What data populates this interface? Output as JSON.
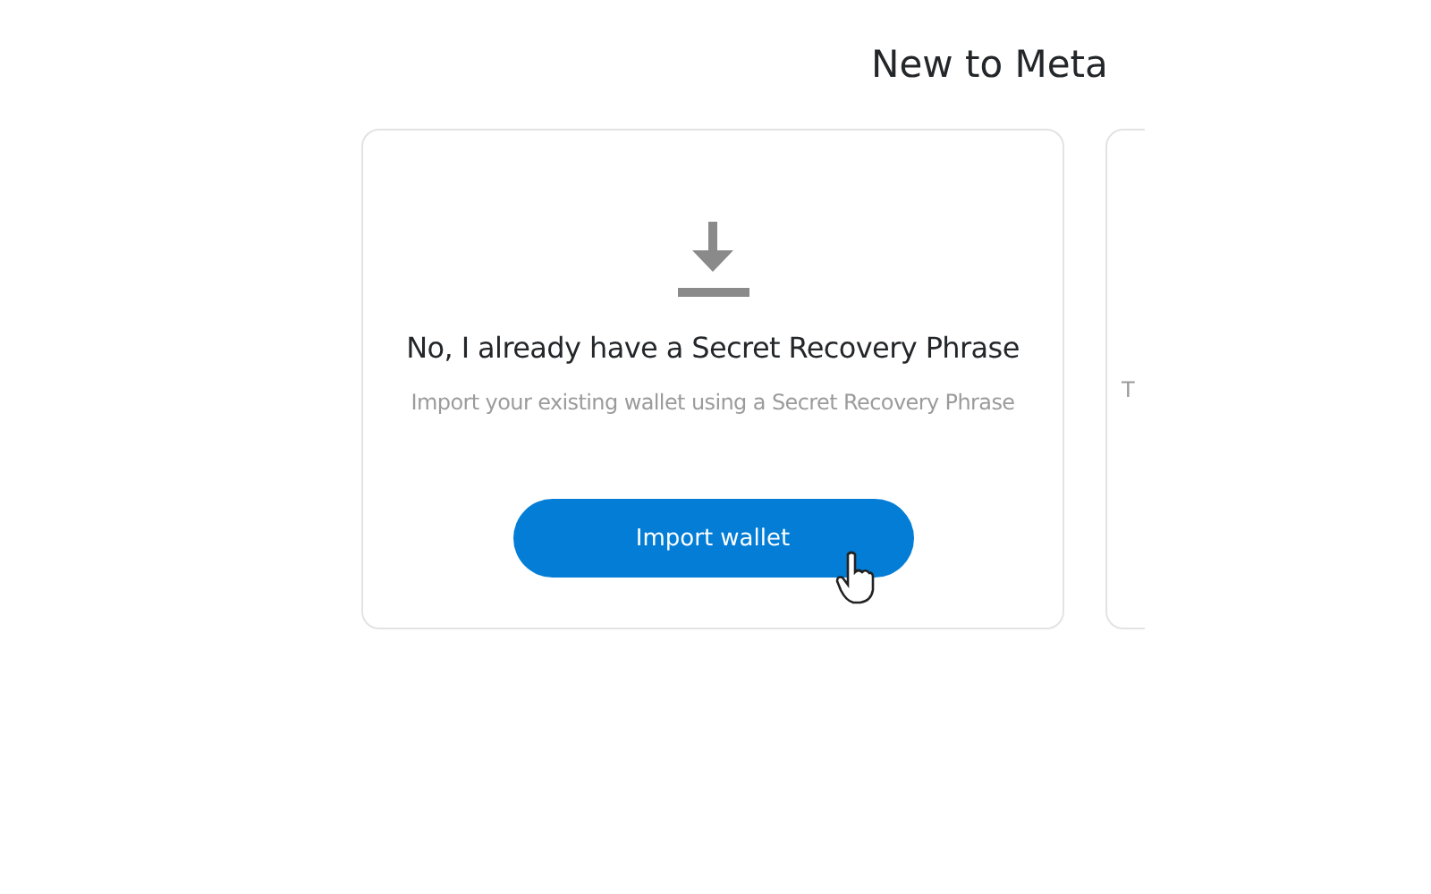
{
  "heading": "New to Meta",
  "cards": [
    {
      "kind": "import",
      "title": "No, I already have a Secret Recovery Phrase",
      "description": "Import your existing wallet using a Secret Recovery Phrase",
      "button": "Import wallet"
    },
    {
      "kind": "partial",
      "description": "T"
    }
  ]
}
